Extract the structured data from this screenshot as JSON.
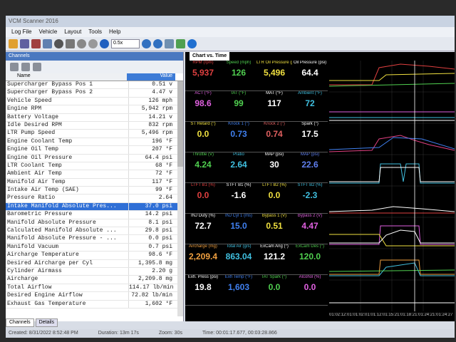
{
  "app": {
    "title": "VCM Scanner 2016"
  },
  "menu": [
    "Log File",
    "Vehicle",
    "Layout",
    "Tools",
    "Help"
  ],
  "toolbar": {
    "speed_combo": "0.5x"
  },
  "channels": {
    "pane_title": "Channels",
    "col_name": "Name",
    "col_value": "Value",
    "rows": [
      {
        "name": "Supercharger Bypass Pos 1",
        "value": "0.51 v"
      },
      {
        "name": "Supercharger Bypass Pos 2",
        "value": "4.47 v"
      },
      {
        "name": "Vehicle Speed",
        "value": "126 mph"
      },
      {
        "name": "Engine RPM",
        "value": "5,942 rpm"
      },
      {
        "name": "Battery Voltage",
        "value": "14.21 v"
      },
      {
        "name": "Idle Desired RPM",
        "value": "832 rpm"
      },
      {
        "name": "LTR Pump Speed",
        "value": "5,496 rpm"
      },
      {
        "name": "Engine Coolant Temp",
        "value": "196 °F"
      },
      {
        "name": "Engine Oil Temp",
        "value": "207 °F"
      },
      {
        "name": "Engine Oil Pressure",
        "value": "64.4 psi"
      },
      {
        "name": "LTR Coolant Temp",
        "value": "68 °F"
      },
      {
        "name": "Ambient Air Temp",
        "value": "72 °F"
      },
      {
        "name": "Manifold Air Temp",
        "value": "117 °F"
      },
      {
        "name": "Intake Air Temp (SAE)",
        "value": "99 °F"
      },
      {
        "name": "Pressure Ratio",
        "value": "2.64"
      },
      {
        "name": "Intake Manifold Absolute Pres...",
        "value": "37.0 psi"
      },
      {
        "name": "Barometric Pressure",
        "value": "14.2 psi"
      },
      {
        "name": "Manifold Absolute Pressure",
        "value": "8.1 psi"
      },
      {
        "name": "Calculated Manifold Absolute ...",
        "value": "29.8 psi"
      },
      {
        "name": "Manifold Absolute Pressure - ...",
        "value": "0.0 psi"
      },
      {
        "name": "Manifold Vacuum",
        "value": "0.7 psi"
      },
      {
        "name": "Aircharge Temperature",
        "value": "98.6 °F"
      },
      {
        "name": "Desired Aircharge per Cyl",
        "value": "1,395.8 mg"
      },
      {
        "name": "Cylinder Airmass",
        "value": "2.20 g"
      },
      {
        "name": "Aircharge",
        "value": "2,209.8 mg"
      },
      {
        "name": "Total Airflow",
        "value": "114.17 lb/min"
      },
      {
        "name": "Desired Engine Airflow",
        "value": "72.82 lb/min"
      },
      {
        "name": "Exhaust Gas Temperature",
        "value": "1,602 °F"
      }
    ],
    "tabs": [
      "Channels",
      "Details"
    ]
  },
  "chart": {
    "tab_label": "Chart vs. Time",
    "cells": [
      [
        {
          "label": "RPM (rpm)",
          "value": "5,937",
          "color": "#e04040"
        },
        {
          "label": "Speed (mph)",
          "value": "126",
          "color": "#50d050"
        },
        {
          "label": "LTR Oil Pressure (psi)",
          "value": "5,496",
          "color": "#f0e040"
        },
        {
          "label": "Oil Pressure (psi)",
          "value": "64.4",
          "color": "#ffffff"
        }
      ],
      [
        {
          "label": "ACT (°F)",
          "value": "98.6",
          "color": "#e060e0"
        },
        {
          "label": "IAT (°F)",
          "value": "99",
          "color": "#50d050"
        },
        {
          "label": "MAT (°F)",
          "value": "117",
          "color": "#ffffff"
        },
        {
          "label": "Ambient (°F)",
          "value": "72",
          "color": "#40c0e0"
        }
      ],
      [
        {
          "label": "ST Retard (°)",
          "value": "0.0",
          "color": "#f0e040"
        },
        {
          "label": "Knock 1 (°)",
          "value": "0.73",
          "color": "#4080f0"
        },
        {
          "label": "Knock 2 (°)",
          "value": "0.74",
          "color": "#e06060"
        },
        {
          "label": "Spark (°)",
          "value": "17.5",
          "color": "#ffffff"
        }
      ],
      [
        {
          "label": "Throttle (V)",
          "value": "4.24",
          "color": "#50d050"
        },
        {
          "label": "Pratio",
          "value": "2.64",
          "color": "#40c0e0"
        },
        {
          "label": "MAP (psi)",
          "value": "30",
          "color": "#ffffff"
        },
        {
          "label": "MAP (psi)",
          "value": "22.6",
          "color": "#6080f0"
        }
      ],
      [
        {
          "label": "LTFT B1 (%)",
          "value": "0.0",
          "color": "#e04040"
        },
        {
          "label": "STFT B1 (%)",
          "value": "-1.6",
          "color": "#ffffff"
        },
        {
          "label": "LTFT B2 (%)",
          "value": "0.0",
          "color": "#f0e040"
        },
        {
          "label": "STFT B2 (%)",
          "value": "-2.3",
          "color": "#40c0e0"
        }
      ],
      [
        {
          "label": "INJ Duty (%)",
          "value": "72.7",
          "color": "#ffffff"
        },
        {
          "label": "INJ Cyl 1 (ms)",
          "value": "15.0",
          "color": "#4080f0"
        },
        {
          "label": "Bypass 1 (V)",
          "value": "0.51",
          "color": "#f0e040"
        },
        {
          "label": "Bypass 2 (V)",
          "value": "4.47",
          "color": "#e060e0"
        }
      ],
      [
        {
          "label": "Aircharge (mg)",
          "value": "2,209.4",
          "color": "#f0a040"
        },
        {
          "label": "Total Air (g/s)",
          "value": "863.04",
          "color": "#40c0e0"
        },
        {
          "label": "ExCam Ang (°)",
          "value": "121.2",
          "color": "#ffffff"
        },
        {
          "label": "ExCam Des (°)",
          "value": "120.0",
          "color": "#50d050"
        }
      ],
      [
        {
          "label": "Exh. Press (psi)",
          "value": "19.8",
          "color": "#ffffff"
        },
        {
          "label": "Exh Temp (°F)",
          "value": "1,603",
          "color": "#4080f0"
        },
        {
          "label": "IAT Spark (°)",
          "value": "0.0",
          "color": "#50d050"
        },
        {
          "label": "Alcohol (%)",
          "value": "0.0",
          "color": "#e060e0"
        }
      ]
    ],
    "x_ticks": "01:02:12:01:01:02:01:01:12:01:15:21:01:18:21:01:24:21:01:24:27"
  },
  "status": {
    "created": "Created: 8/31/2022 8:52:48 PM",
    "duration": "Duration: 13m 17s",
    "zoom": "Zoom: 30s",
    "time": "Time: 00:01:17.677, 00:03:28.866"
  }
}
